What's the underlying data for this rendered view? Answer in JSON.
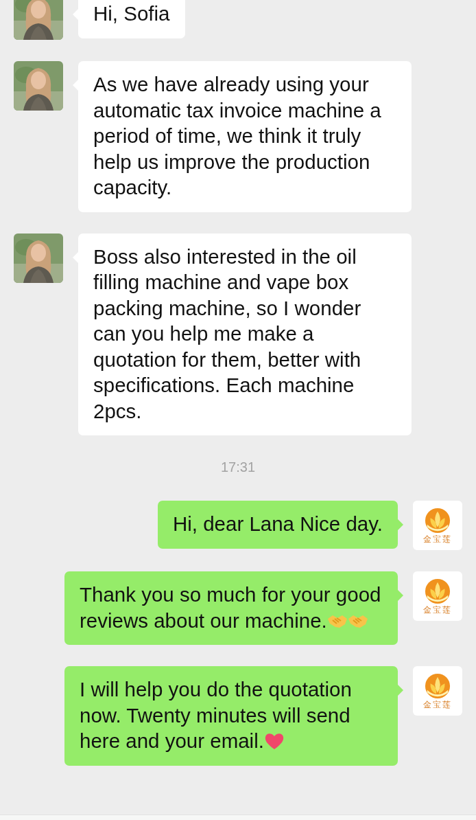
{
  "messages": [
    {
      "kind": "incoming",
      "text": "Hi, Sofia"
    },
    {
      "kind": "incoming",
      "text": "As we have already using your automatic tax invoice machine a period of time, we think it truly help us improve the production capacity."
    },
    {
      "kind": "incoming",
      "text": "Boss also interested in the oil filling machine and vape box packing machine, so I wonder can you help me make a quotation for them, better with specifications. Each machine 2pcs."
    },
    {
      "kind": "time",
      "text": "17:31"
    },
    {
      "kind": "outgoing",
      "avatar": {
        "kind": "logo",
        "text": "金宝莲"
      },
      "text": "Hi, dear Lana Nice day."
    },
    {
      "kind": "outgoing",
      "avatar": {
        "kind": "logo",
        "text": "金宝莲"
      },
      "text": "Thank you so much for your good reviews about our machine.",
      "emojis": [
        {
          "kind": "handshake"
        },
        {
          "kind": "handshake"
        }
      ]
    },
    {
      "kind": "outgoing",
      "avatar": {
        "kind": "logo",
        "text": "金宝莲"
      },
      "text": "I will help you do the quotation now. Twenty minutes will send here and your email.",
      "emojis": [
        {
          "kind": "heart"
        }
      ]
    }
  ]
}
